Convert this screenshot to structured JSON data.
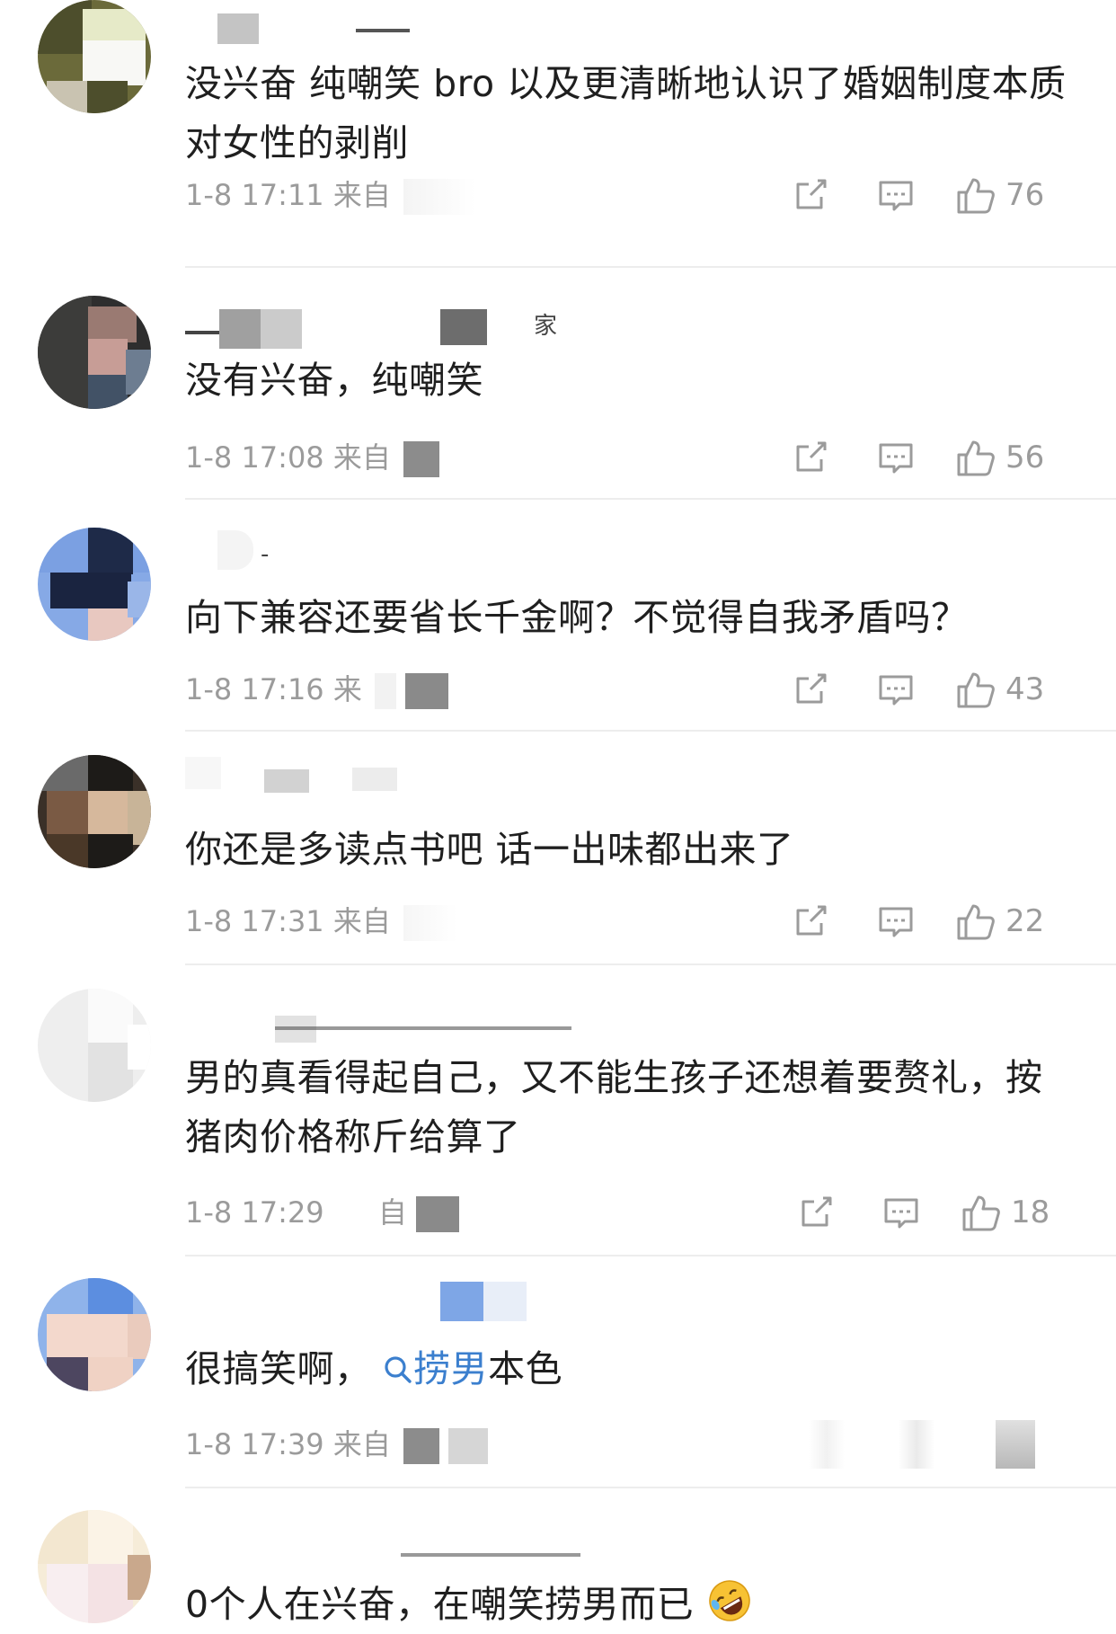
{
  "comments": [
    {
      "username_fragment": "",
      "text": "没兴奋 纯嘲笑 bro 以及更清晰地认识了婚姻制度本质对女性的剥削",
      "time": "1-8 17:11",
      "source": "来自",
      "likes": "76"
    },
    {
      "username_fragment": "家",
      "text": "没有兴奋，纯嘲笑",
      "time": "1-8 17:08",
      "source": "来自",
      "likes": "56"
    },
    {
      "username_fragment": "-",
      "text": "向下兼容还要省长千金啊？不觉得自我矛盾吗？",
      "time": "1-8 17:16",
      "source": "来",
      "likes": "43"
    },
    {
      "username_fragment": "",
      "text": "你还是多读点书吧 话一出味都出来了",
      "time": "1-8 17:31",
      "source": "来自",
      "likes": "22"
    },
    {
      "username_fragment": "",
      "text": "男的真看得起自己，又不能生孩子还想着要赘礼，按猪肉价格称斤给算了",
      "time": "1-8 17:29",
      "source": "自",
      "likes": "18"
    },
    {
      "username_fragment": "",
      "text_before": "很搞笑啊，",
      "link_text": "捞男",
      "text_after": "本色",
      "time": "1-8 17:39",
      "source": "来自",
      "likes": ""
    },
    {
      "username_fragment": "",
      "text": "0个人在兴奋，在嘲笑捞男而已",
      "emoji": "rolling-on-floor-laughing-emoji"
    }
  ],
  "icons": {
    "share": "share-icon",
    "comment": "comment-icon",
    "like": "thumbs-up-icon",
    "search": "search-icon"
  },
  "colors": {
    "link": "#3b7fce",
    "meta": "#9b9b9b",
    "divider": "#ededed"
  }
}
